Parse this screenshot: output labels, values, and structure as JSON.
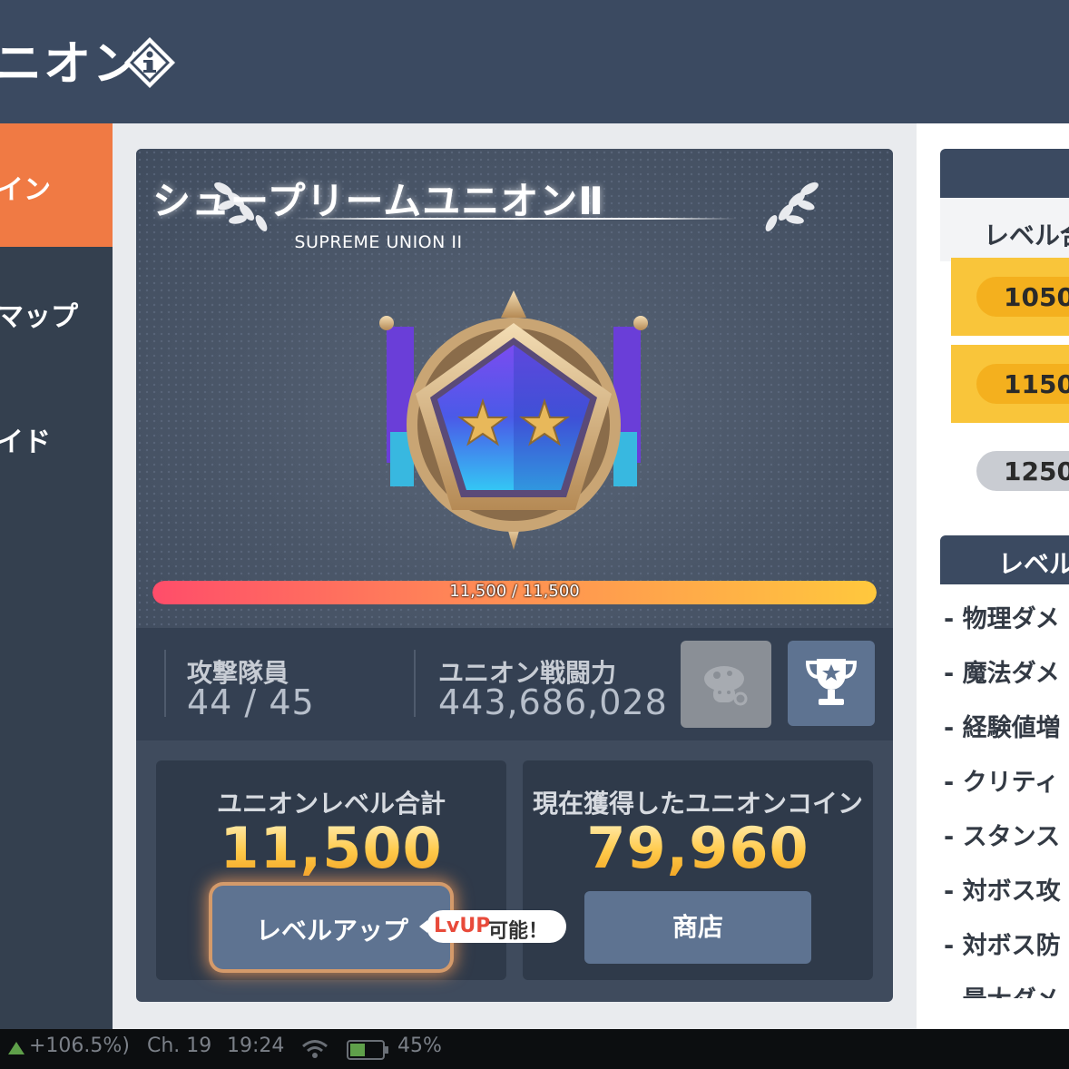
{
  "header": {
    "title": "ニオン",
    "info_icon": "info-icon"
  },
  "sidebar": {
    "items": [
      {
        "label": "イン",
        "active": true
      },
      {
        "label": "マップ",
        "active": false
      },
      {
        "label": "イド",
        "active": false
      }
    ]
  },
  "union": {
    "rank_title": "シュープリームユニオンⅡ",
    "rank_subtitle": "SUPREME UNION II",
    "exp_text": "11,500 / 11,500",
    "exp_progress": 1.0,
    "members_label": "攻撃隊員",
    "members_value": "44 / 45",
    "power_label": "ユニオン戦闘力",
    "power_value": "443,686,028",
    "level_total_label": "ユニオンレベル合計",
    "level_total_value": "11,500",
    "level_up_button": "レベルアップ",
    "level_up_badge_a": "LvUP",
    "level_up_badge_b": "可能！",
    "coin_label": "現在獲得したユニオンコイン",
    "coin_value": "79,960",
    "shop_button": "商店"
  },
  "right_panel": {
    "column_header": "レベル合",
    "levels": [
      {
        "value": "1050",
        "state": "achieved"
      },
      {
        "value": "1150",
        "state": "achieved"
      },
      {
        "value": "1250",
        "state": "locked"
      }
    ],
    "bonus_header": "レベル",
    "bonus_items": [
      "- 物理ダメ",
      "- 魔法ダメ",
      "- 経験値増",
      "- クリティ",
      "- スタンス",
      "- 対ボス攻",
      "- 対ボス防",
      "- 最大ダメ"
    ]
  },
  "status_bar": {
    "change": "+106.5%)",
    "channel": "Ch. 19",
    "time": "19:24",
    "battery": "45%"
  },
  "colors": {
    "accent": "#f07a44",
    "header": "#3b4a61",
    "gold": "#ffc24a",
    "pill_gold": "#f7b92a",
    "pill_grey": "#c9ccd2"
  }
}
